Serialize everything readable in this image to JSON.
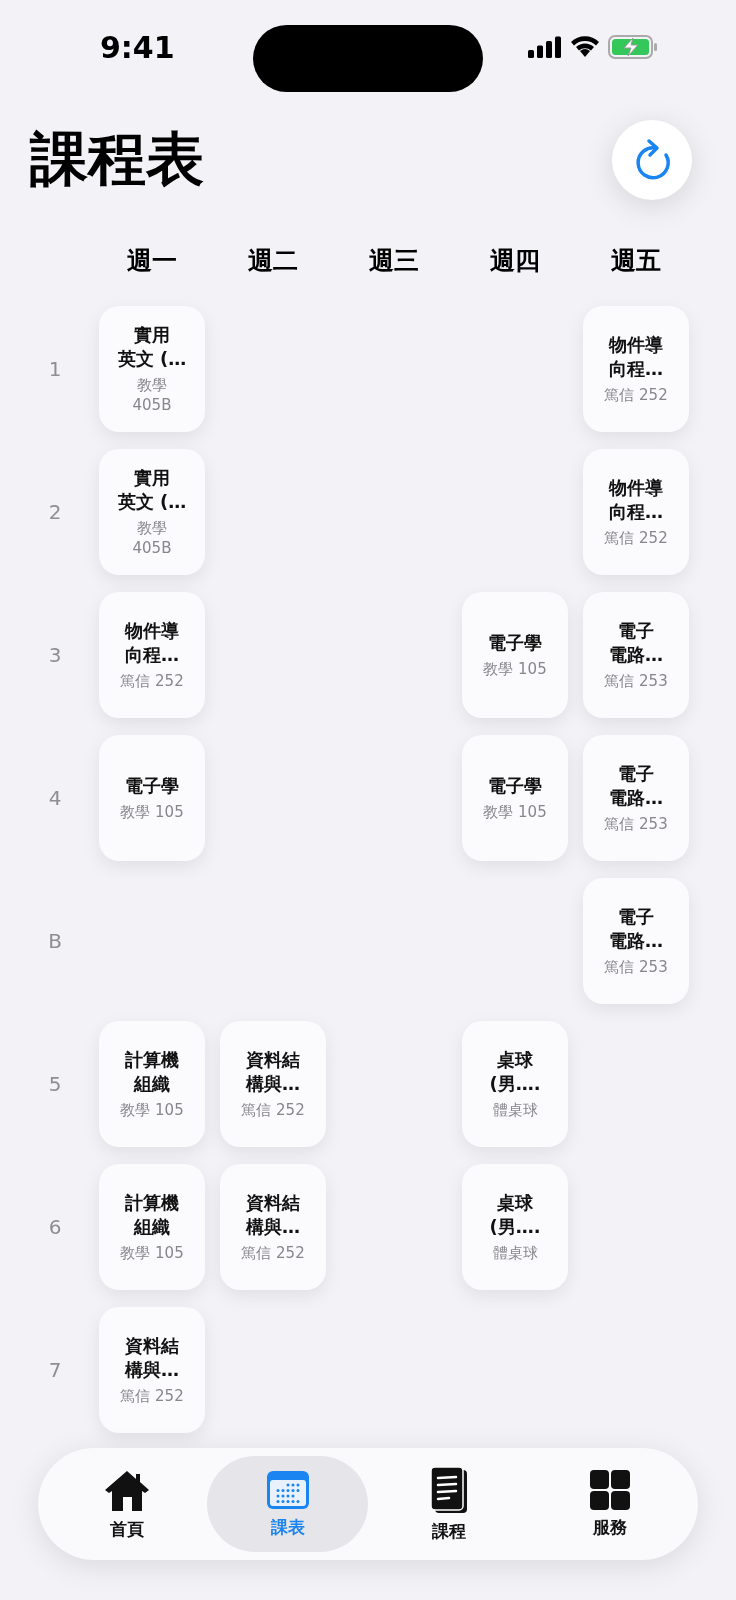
{
  "status_bar": {
    "time": "9:41"
  },
  "title": "課程表",
  "days": [
    "週一",
    "週二",
    "週三",
    "週四",
    "週五"
  ],
  "periods": [
    {
      "label": "1",
      "cells": [
        {
          "kind": "class",
          "title": [
            "實用",
            "英文 (…"
          ],
          "room": [
            "教學",
            "405B"
          ]
        },
        {
          "kind": "empty"
        },
        {
          "kind": "empty"
        },
        {
          "kind": "empty"
        },
        {
          "kind": "class",
          "title": [
            "物件導",
            "向程…"
          ],
          "room": [
            "篤信 252"
          ]
        }
      ]
    },
    {
      "label": "2",
      "cells": [
        {
          "kind": "class",
          "title": [
            "實用",
            "英文 (…"
          ],
          "room": [
            "教學",
            "405B"
          ]
        },
        {
          "kind": "empty"
        },
        {
          "kind": "empty"
        },
        {
          "kind": "empty"
        },
        {
          "kind": "class",
          "title": [
            "物件導",
            "向程…"
          ],
          "room": [
            "篤信 252"
          ]
        }
      ]
    },
    {
      "label": "3",
      "cells": [
        {
          "kind": "class",
          "title": [
            "物件導",
            "向程…"
          ],
          "room": [
            "篤信 252"
          ]
        },
        {
          "kind": "empty"
        },
        {
          "kind": "empty"
        },
        {
          "kind": "class",
          "title": [
            "電子學"
          ],
          "room": [
            "教學 105"
          ]
        },
        {
          "kind": "class",
          "title": [
            "電子",
            "電路…"
          ],
          "room": [
            "篤信 253"
          ]
        }
      ]
    },
    {
      "label": "4",
      "cells": [
        {
          "kind": "class",
          "title": [
            "電子學"
          ],
          "room": [
            "教學 105"
          ]
        },
        {
          "kind": "empty"
        },
        {
          "kind": "empty"
        },
        {
          "kind": "class",
          "title": [
            "電子學"
          ],
          "room": [
            "教學 105"
          ]
        },
        {
          "kind": "class",
          "title": [
            "電子",
            "電路…"
          ],
          "room": [
            "篤信 253"
          ]
        }
      ]
    },
    {
      "label": "B",
      "cells": [
        {
          "kind": "empty"
        },
        {
          "kind": "empty"
        },
        {
          "kind": "empty"
        },
        {
          "kind": "empty"
        },
        {
          "kind": "class",
          "title": [
            "電子",
            "電路…"
          ],
          "room": [
            "篤信 253"
          ]
        }
      ]
    },
    {
      "label": "5",
      "cells": [
        {
          "kind": "class",
          "title": [
            "計算機",
            "組織"
          ],
          "room": [
            "教學 105"
          ]
        },
        {
          "kind": "class",
          "title": [
            "資料結",
            "構與…"
          ],
          "room": [
            "篤信 252"
          ]
        },
        {
          "kind": "empty"
        },
        {
          "kind": "class",
          "title": [
            "桌球",
            "(男…."
          ],
          "room": [
            "體桌球"
          ]
        },
        {
          "kind": "empty"
        }
      ]
    },
    {
      "label": "6",
      "cells": [
        {
          "kind": "class",
          "title": [
            "計算機",
            "組織"
          ],
          "room": [
            "教學 105"
          ]
        },
        {
          "kind": "class",
          "title": [
            "資料結",
            "構與…"
          ],
          "room": [
            "篤信 252"
          ]
        },
        {
          "kind": "empty"
        },
        {
          "kind": "class",
          "title": [
            "桌球",
            "(男…."
          ],
          "room": [
            "體桌球"
          ]
        },
        {
          "kind": "empty"
        }
      ]
    },
    {
      "label": "7",
      "cells": [
        {
          "kind": "class",
          "title": [
            "資料結",
            "構與…"
          ],
          "room": [
            "篤信 252"
          ]
        },
        {
          "kind": "empty"
        },
        {
          "kind": "empty"
        },
        {
          "kind": "empty"
        },
        {
          "kind": "empty"
        }
      ]
    }
  ],
  "tabs": [
    {
      "kind": "home",
      "label": "首頁",
      "selected": false
    },
    {
      "kind": "calendar",
      "label": "課表",
      "selected": true
    },
    {
      "kind": "book",
      "label": "課程",
      "selected": false
    },
    {
      "kind": "grid",
      "label": "服務",
      "selected": false
    }
  ]
}
